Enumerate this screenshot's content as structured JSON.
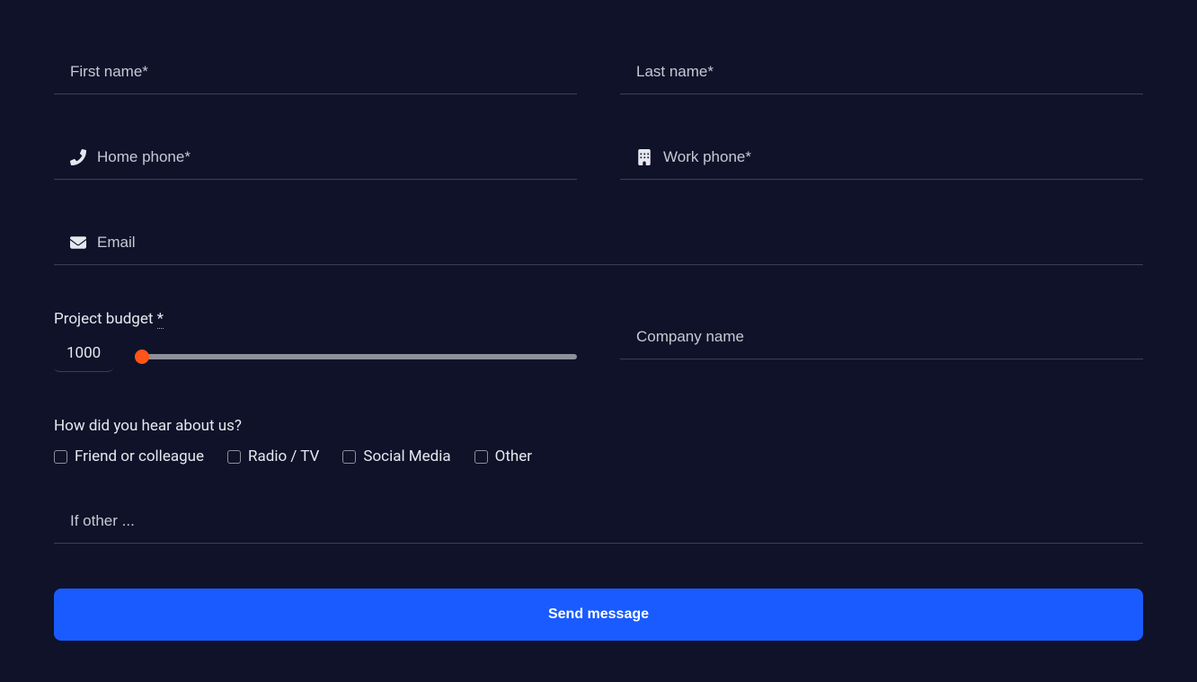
{
  "form": {
    "first_name": {
      "placeholder": "First name*"
    },
    "last_name": {
      "placeholder": "Last name*"
    },
    "home_phone": {
      "placeholder": "Home phone*"
    },
    "work_phone": {
      "placeholder": "Work phone*"
    },
    "email": {
      "placeholder": "Email"
    },
    "company_name": {
      "placeholder": "Company name"
    },
    "budget": {
      "label": "Project budget ",
      "required_mark": "*",
      "value": "1000",
      "min": "1000",
      "max": "50000"
    },
    "hear_about": {
      "label": "How did you hear about us?",
      "options": [
        "Friend or colleague",
        "Radio / TV",
        "Social Media",
        "Other"
      ]
    },
    "if_other": {
      "placeholder": "If other ..."
    },
    "submit_label": "Send message"
  }
}
